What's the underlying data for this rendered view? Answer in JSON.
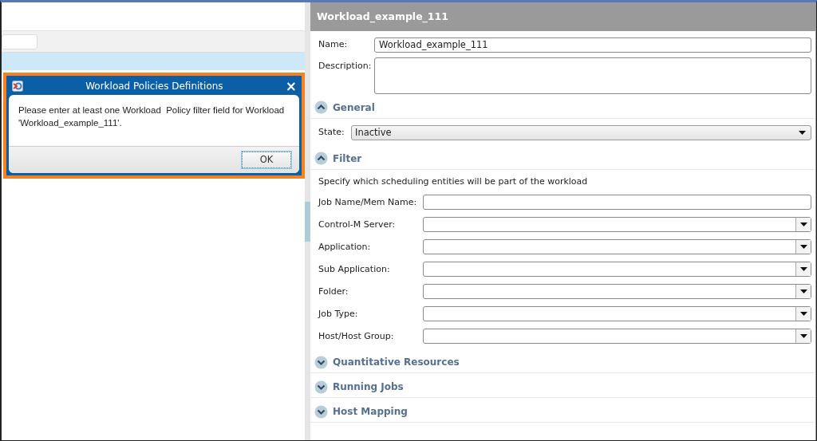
{
  "dialog": {
    "title": "Workload Policies Definitions",
    "message": "Please enter at least one Workload  Policy filter field for Workload 'Workload_example_111'.",
    "ok_button": "OK",
    "close_button": "×"
  },
  "details": {
    "title": "Workload_example_111",
    "name_label": "Name:",
    "name_value": "Workload_example_111",
    "description_label": "Description:",
    "sections": [
      {
        "title": "General",
        "expanded": true,
        "fields": [
          {
            "label": "State:",
            "kind": "select",
            "value": "Inactive"
          }
        ]
      },
      {
        "title": "Filter",
        "expanded": true,
        "description": "Specify which scheduling entities will be part of the workload",
        "fields": [
          {
            "label": "Job Name/Mem Name:",
            "kind": "text"
          },
          {
            "label": "Control-M Server:",
            "kind": "combo"
          },
          {
            "label": "Application:",
            "kind": "combo"
          },
          {
            "label": "Sub Application:",
            "kind": "combo"
          },
          {
            "label": "Folder:",
            "kind": "combo"
          },
          {
            "label": "Job Type:",
            "kind": "combo"
          },
          {
            "label": "Host/Host Group:",
            "kind": "combo"
          }
        ]
      },
      {
        "title": "Quantitative Resources",
        "expanded": false
      },
      {
        "title": "Running Jobs",
        "expanded": false
      },
      {
        "title": "Host Mapping",
        "expanded": false
      }
    ]
  }
}
